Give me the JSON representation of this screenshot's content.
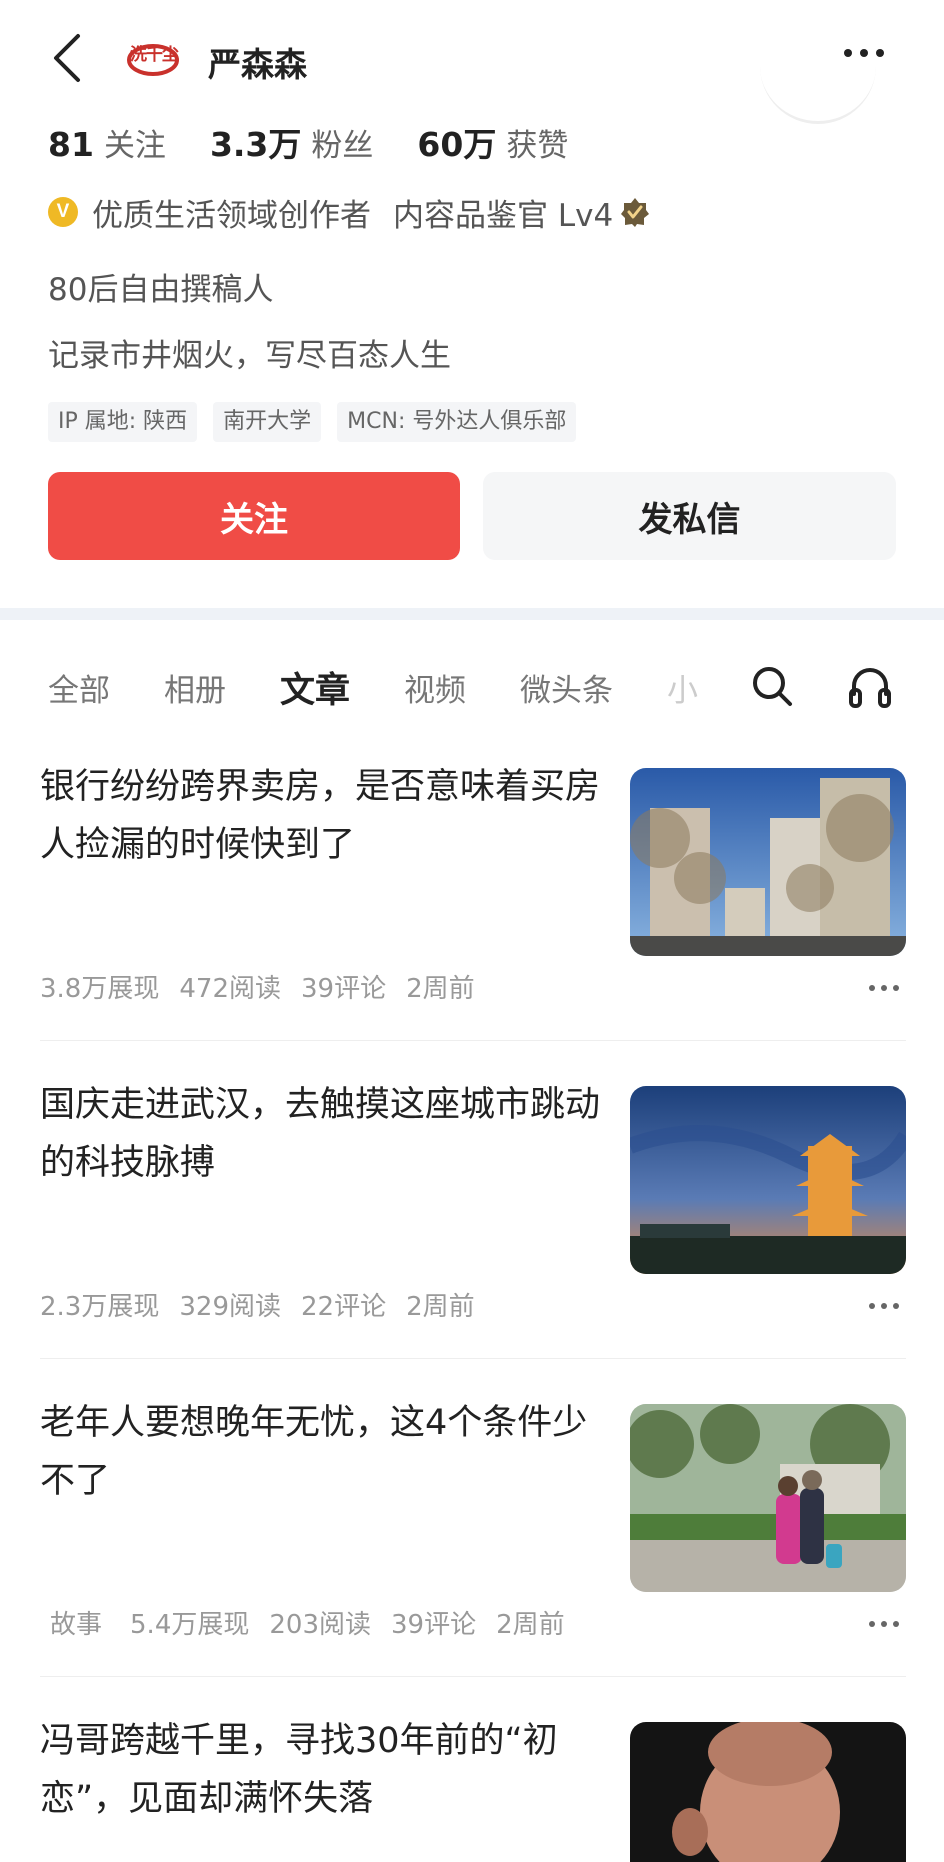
{
  "header": {
    "logo_text": "洗千尘",
    "username": "严森森"
  },
  "stats": [
    {
      "num": "81",
      "label": "关注"
    },
    {
      "num": "3.3万",
      "label": "粉丝"
    },
    {
      "num": "60万",
      "label": "获赞"
    }
  ],
  "creator": {
    "badge": "V",
    "title": "优质生活领域创作者",
    "level": "内容品鉴官 Lv4"
  },
  "bio": [
    "80后自由撰稿人",
    "记录市井烟火，写尽百态人生"
  ],
  "tags": [
    "IP 属地: 陕西",
    "南开大学",
    "MCN: 号外达人俱乐部"
  ],
  "buttons": {
    "follow": "关注",
    "message": "发私信"
  },
  "tabs": [
    "全部",
    "相册",
    "文章",
    "视频",
    "微头条",
    "小"
  ],
  "active_tab": "文章",
  "articles": [
    {
      "title": "银行纷纷跨界卖房，是否意味着买房人捡漏的时候快到了",
      "meta": [
        "3.8万展现",
        "472阅读",
        "39评论",
        "2周前"
      ]
    },
    {
      "title": "国庆走进武汉，去触摸这座城市跳动的科技脉搏",
      "meta": [
        "2.3万展现",
        "329阅读",
        "22评论",
        "2周前"
      ]
    },
    {
      "title": "老年人要想晚年无忧，这4个条件少不了",
      "meta": [
        "故事",
        "5.4万展现",
        "203阅读",
        "39评论",
        "2周前"
      ]
    },
    {
      "title": "冯哥跨越千里，寻找30年前的“初恋”，见面却满怀失落",
      "meta": []
    }
  ],
  "colors": {
    "accent": "#f04c46",
    "badge": "#efb925"
  }
}
